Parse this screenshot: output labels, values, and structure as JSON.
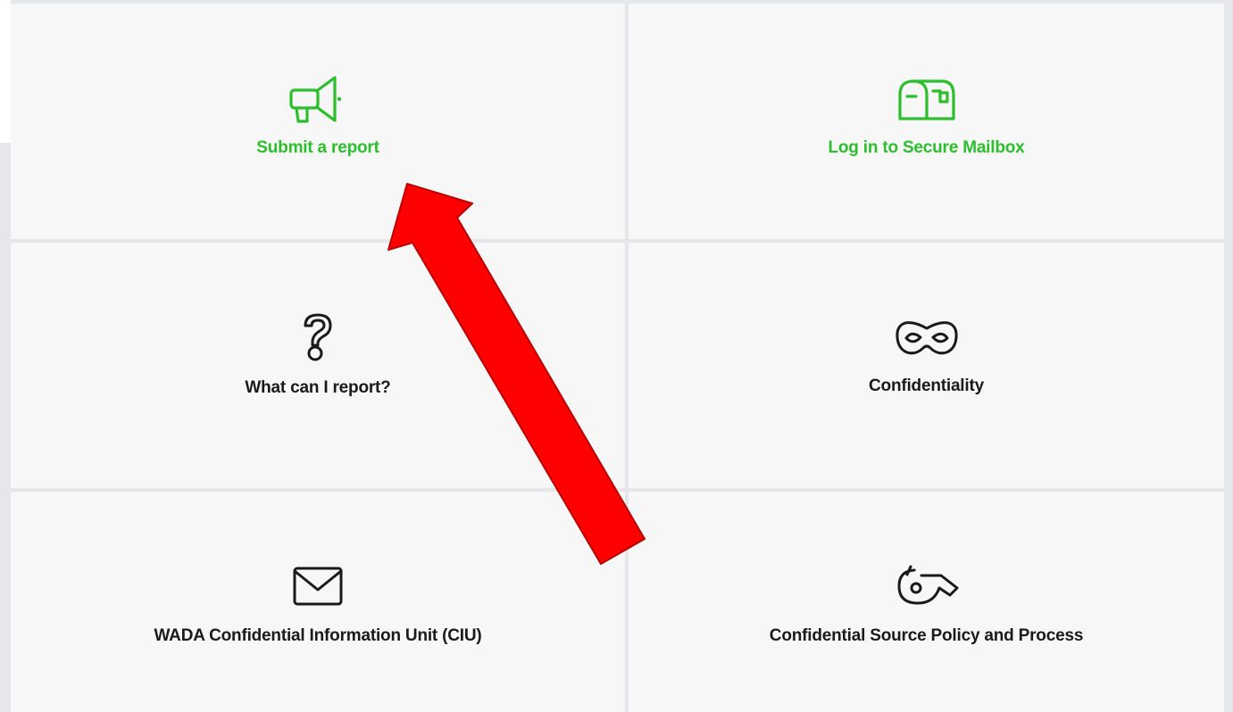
{
  "tiles": {
    "submit_report": {
      "label": "Submit a report",
      "icon": "megaphone-icon",
      "color": "#2dbe2d"
    },
    "secure_mailbox": {
      "label": "Log in to Secure Mailbox",
      "icon": "mailbox-icon",
      "color": "#2dbe2d"
    },
    "what_report": {
      "label": "What can I report?",
      "icon": "question-mark-icon",
      "color": "#1a1a1a"
    },
    "confidentiality": {
      "label": "Confidentiality",
      "icon": "mask-icon",
      "color": "#1a1a1a"
    },
    "ciu": {
      "label": "WADA Confidential Information Unit (CIU)",
      "icon": "envelope-icon",
      "color": "#1a1a1a"
    },
    "source_policy": {
      "label": "Confidential Source Policy and Process",
      "icon": "whistle-icon",
      "color": "#1a1a1a"
    }
  },
  "annotation": {
    "icon": "red-arrow-icon",
    "color": "#ff0000"
  }
}
